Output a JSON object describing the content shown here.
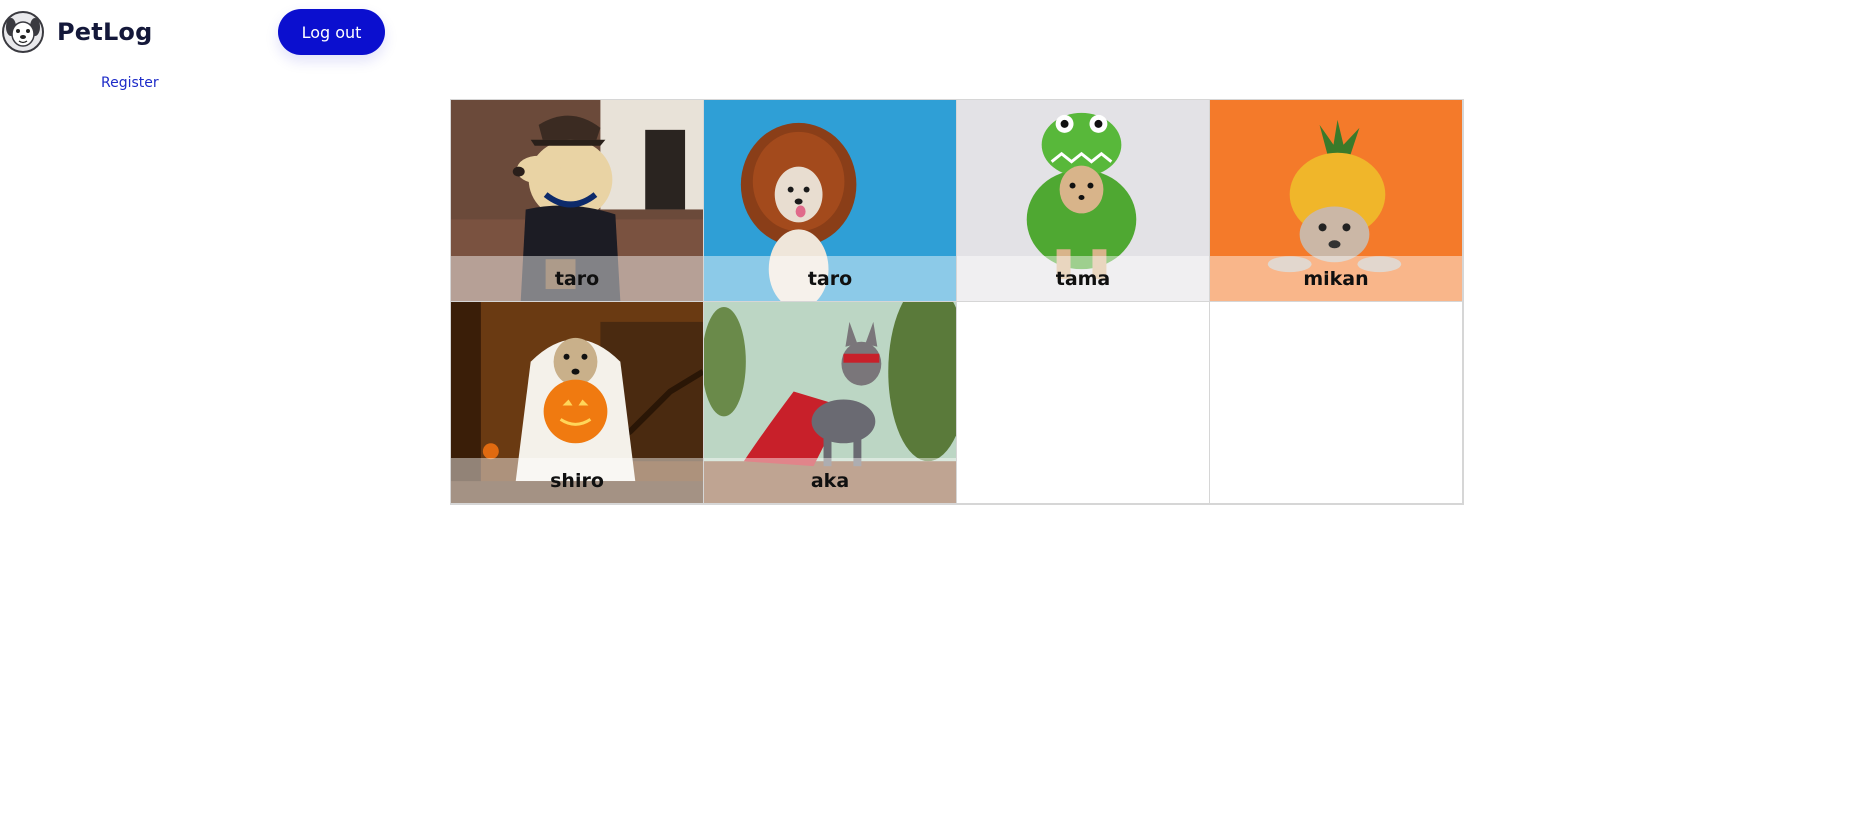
{
  "header": {
    "brand_name": "PetLog",
    "logo_icon": "dog-face-icon",
    "logout_label": "Log out",
    "register_label": "Register"
  },
  "colors": {
    "primary": "#0b0fcf",
    "link": "#1d2bc8",
    "brand_text": "#14183a"
  },
  "pets": [
    {
      "name": "taro",
      "photo": "dog-in-delivery-cap"
    },
    {
      "name": "taro",
      "photo": "dog-in-lion-mane"
    },
    {
      "name": "tama",
      "photo": "chihuahua-in-dinosaur-costume"
    },
    {
      "name": "mikan",
      "photo": "bulldog-in-pineapple-costume"
    },
    {
      "name": "shiro",
      "photo": "dog-in-ghost-costume-with-pumpkin"
    },
    {
      "name": "aka",
      "photo": "bulldog-in-superhero-cape"
    }
  ]
}
